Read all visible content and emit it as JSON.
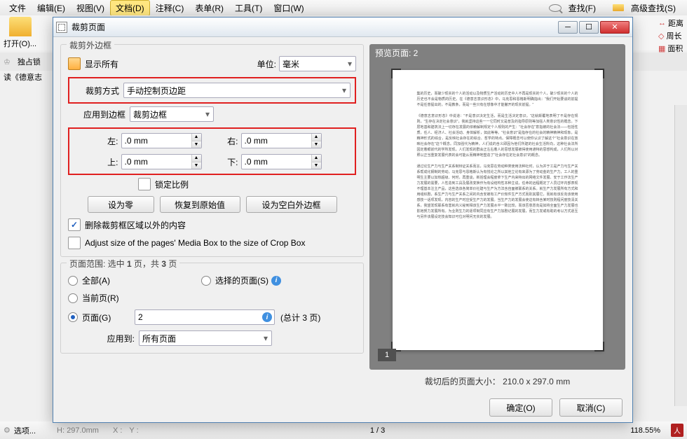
{
  "menubar": {
    "items": [
      "文件",
      "编辑(E)",
      "视图(V)",
      "文档(D)",
      "注释(C)",
      "表单(R)",
      "工具(T)",
      "窗口(W)"
    ],
    "search": "查找(F)",
    "adv_search": "高级查找(S)"
  },
  "bg": {
    "open": "打开(O)...",
    "exclusive": "独占锁",
    "read": "读《德意志",
    "right": [
      "距离",
      "周长",
      "面积"
    ],
    "options": "选项...",
    "height": "H: 297.0mm",
    "xlabel": "X :",
    "ylabel": "Y :",
    "page": "1 / 3",
    "zoom": "118.55%"
  },
  "dialog": {
    "title": "裁剪页面",
    "groupbox1": "裁剪外边框",
    "show_all": "显示所有",
    "unit_label": "单位:",
    "unit_value": "毫米",
    "crop_mode_label": "裁剪方式",
    "crop_mode_value": "手动控制页边距",
    "apply_bbox_label": "应用到边框",
    "apply_bbox_value": "裁剪边框",
    "left_label": "左:",
    "right_label": "右:",
    "top_label": "上:",
    "bottom_label": "下:",
    "margin_value": ".0 mm",
    "lock_ratio": "锁定比例",
    "btn_zero": "设为零",
    "btn_restore": "恢复到原始值",
    "btn_blank": "设为空白外边框",
    "del_outside": "删除裁剪框区域以外的内容",
    "adjust_media": "Adjust size of the pages' Media Box to the size of Crop Box",
    "range_title_prefix": "页面范围: 选中 ",
    "range_selected": "1",
    "range_middle": " 页，共 ",
    "range_total": "3",
    "range_suffix": " 页",
    "radio_all": "全部(A)",
    "radio_current": "当前页(R)",
    "radio_page": "页面(G)",
    "radio_selected": "选择的页面(S)",
    "page_input": "2",
    "total_pages": "(总计 3 页)",
    "apply_to_label": "应用到:",
    "apply_to_value": "所有页面",
    "preview_header": "预览页面:  2",
    "page_label": "1",
    "crop_size": "裁切后的页面大小： 210.0 x 297.0 mm",
    "ok": "确定(O)",
    "cancel": "取消(C)"
  }
}
